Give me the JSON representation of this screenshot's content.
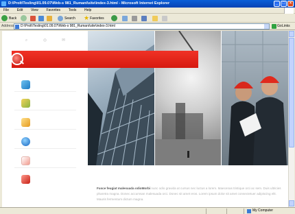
{
  "window": {
    "title": "D:\\Prolt\\Tesling\\01.09.07\\Web-s 981_Rumani\\site\\index-3.html - Microsoft Internet Explorer",
    "controls": [
      "_",
      "□",
      "×"
    ]
  },
  "menubar": {
    "items": [
      "File",
      "Edit",
      "View",
      "Favorites",
      "Tools",
      "Help"
    ]
  },
  "toolbar": {
    "back_label": "Back",
    "search_label": "Search",
    "favorites_label": "Favorites"
  },
  "addressbar": {
    "label": "Address",
    "url": "D:\\Prolt\\Tesling\\01.09.07\\Web-s 981_Rumani\\site\\index-3.html",
    "go_label": "Go",
    "links_label": "Links"
  },
  "statusbar": {
    "zone": "My Computer"
  },
  "page": {
    "top_icons": [
      "⌕",
      "◎",
      "✉"
    ],
    "body_lead": "Fusce feugiat malesuada odioMorbi",
    "body_text": "nunc odio gravida at cursus nec luctus a lorem. Maecenas tristique orci ac sem. Duis ultricies pharetra magna. Donec accumsan malesuada orci. Donec sit amet eros. Lorem ipsum dolor sit amet consectetuer adipiscing elit. Mauris fermentum dictum magna."
  },
  "colors": {
    "brand_red": "#e0241a",
    "xp_blue": "#0a5fd8",
    "chrome": "#ece9d8"
  }
}
